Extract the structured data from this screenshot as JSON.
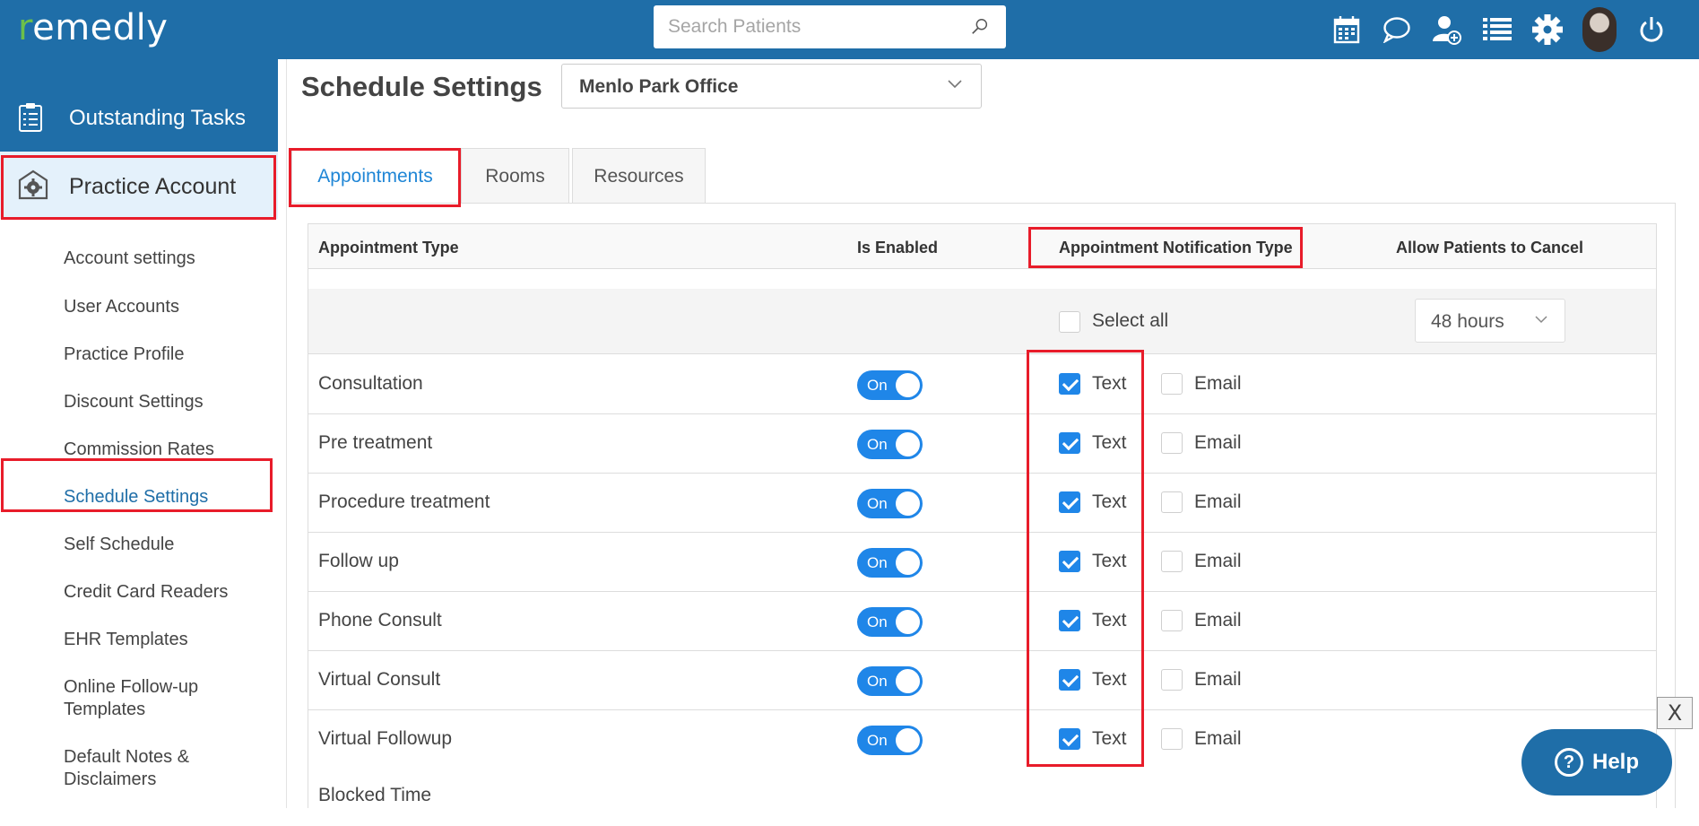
{
  "app": {
    "logo": "remedly",
    "logo_accent": "r"
  },
  "search": {
    "placeholder": "Search Patients"
  },
  "top_icons": [
    "calendar-icon",
    "chat-icon",
    "add-user-icon",
    "list-icon",
    "settings-gear-icon",
    "user-avatar",
    "power-icon"
  ],
  "sidebar": {
    "outstanding_tasks": "Outstanding Tasks",
    "practice_account": "Practice Account",
    "items": [
      {
        "label": "Account settings"
      },
      {
        "label": "User Accounts"
      },
      {
        "label": "Practice Profile"
      },
      {
        "label": "Discount Settings"
      },
      {
        "label": "Commission Rates"
      },
      {
        "label": "Schedule Settings",
        "active": true
      },
      {
        "label": "Self Schedule"
      },
      {
        "label": "Credit Card Readers"
      },
      {
        "label": "EHR Templates"
      },
      {
        "label": "Online Follow-up Templates"
      },
      {
        "label": "Default Notes & Disclaimers"
      }
    ]
  },
  "main": {
    "title": "Schedule Settings",
    "office": "Menlo Park Office",
    "tabs": [
      {
        "label": "Appointments",
        "active": true
      },
      {
        "label": "Rooms"
      },
      {
        "label": "Resources"
      }
    ],
    "table": {
      "headers": {
        "type": "Appointment Type",
        "enabled": "Is Enabled",
        "notification": "Appointment Notification Type",
        "cancel": "Allow Patients to Cancel"
      },
      "select_all_label": "Select all",
      "cancel_window": "48 hours",
      "toggle_on_label": "On",
      "text_label": "Text",
      "email_label": "Email",
      "rows": [
        {
          "name": "Consultation",
          "enabled": true,
          "text": true,
          "email": false
        },
        {
          "name": "Pre treatment",
          "enabled": true,
          "text": true,
          "email": false
        },
        {
          "name": "Procedure treatment",
          "enabled": true,
          "text": true,
          "email": false
        },
        {
          "name": "Follow up",
          "enabled": true,
          "text": true,
          "email": false
        },
        {
          "name": "Phone Consult",
          "enabled": true,
          "text": true,
          "email": false
        },
        {
          "name": "Virtual Consult",
          "enabled": true,
          "text": true,
          "email": false
        },
        {
          "name": "Virtual Followup",
          "enabled": true,
          "text": true,
          "email": false
        }
      ],
      "partial_row": "Blocked Time"
    }
  },
  "widgets": {
    "close_label": "X",
    "help_label": "Help",
    "help_icon": "?"
  },
  "colors": {
    "brand": "#1f6ea8",
    "accent": "#1f86e8",
    "highlight": "#e81c2a",
    "logo_accent": "#6cc04a"
  }
}
